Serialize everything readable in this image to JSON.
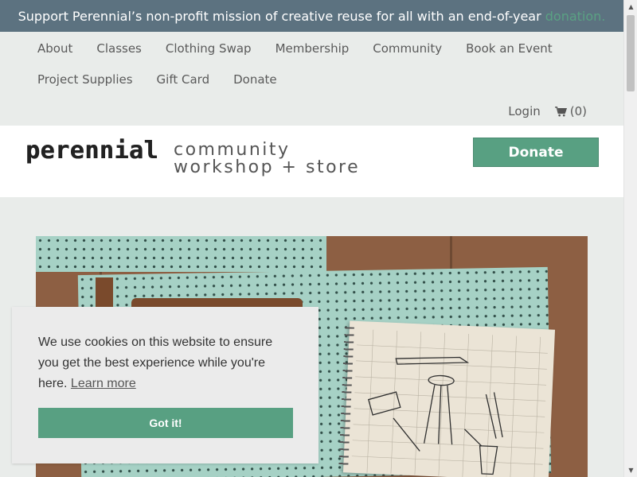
{
  "announcement": {
    "text": "Support Perennial’s non-profit mission of creative reuse for all with an end-of-year ",
    "link": "donation."
  },
  "nav": {
    "row1": [
      "About",
      "Classes",
      "Clothing Swap",
      "Membership",
      "Community",
      "Book an Event"
    ],
    "row2": [
      "Project Supplies",
      "Gift Card",
      "Donate"
    ],
    "login": "Login",
    "cart_count": "(0)"
  },
  "header": {
    "logo_word": "perennial",
    "logo_line1": "community",
    "logo_line2": "workshop + store",
    "donate_label": "Donate"
  },
  "cookie": {
    "message": "We use cookies on this website to ensure you get the best experience while you're here.",
    "learn_more": "Learn more",
    "button": "Got it!"
  },
  "colors": {
    "accent": "#58a082",
    "announcement_bg": "#5c7280",
    "page_bg": "#e9ecea"
  },
  "icons": {
    "cart": "shopping-cart-icon",
    "scroll_up": "chevron-up-icon",
    "scroll_down": "chevron-down-icon"
  }
}
